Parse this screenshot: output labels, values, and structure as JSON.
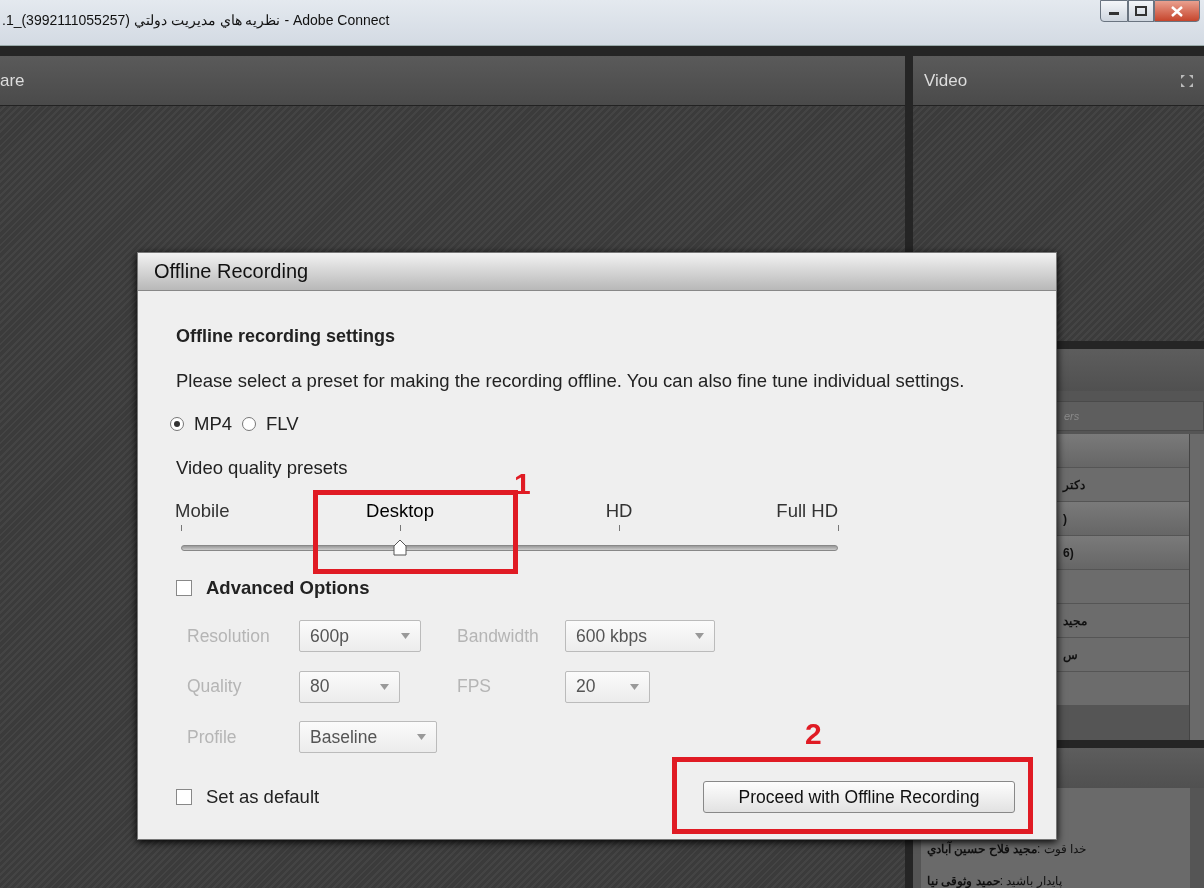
{
  "window": {
    "title": ".1_(3992111055257) نظريه هاي مديريت دولتي - Adobe Connect"
  },
  "share_pod": {
    "title": "are"
  },
  "video_pod": {
    "title": "Video"
  },
  "attendees_pod": {
    "search_placeholder": "ers",
    "rows": [
      {
        "kind": "group"
      },
      {
        "kind": "person",
        "text": "دکتر"
      },
      {
        "kind": "group",
        "text": ")"
      },
      {
        "kind": "group",
        "text": "6)"
      },
      {
        "kind": "person"
      },
      {
        "kind": "person",
        "text": "مجید"
      },
      {
        "kind": "person",
        "text": "س"
      },
      {
        "kind": "person"
      }
    ]
  },
  "chat_pod": {
    "messages": [
      {
        "text": "خدا قوت :**مجید فلاح حسین آبادي**"
      },
      {
        "text": "پایدار باشید :**حمید وثوقی نیا**"
      }
    ]
  },
  "dialog": {
    "title": "Offline Recording",
    "heading": "Offline recording settings",
    "description": "Please select a preset for making the recording offline. You can also fine tune individual settings.",
    "formats": [
      {
        "label": "MP4",
        "selected": true
      },
      {
        "label": "FLV",
        "selected": false
      }
    ],
    "presets_label": "Video quality presets",
    "presets": [
      {
        "label": "Mobile",
        "selected": false
      },
      {
        "label": "Desktop",
        "selected": true
      },
      {
        "label": "HD",
        "selected": false
      },
      {
        "label": "Full HD",
        "selected": false
      }
    ],
    "slider": {
      "level": 0.333
    },
    "advanced": {
      "label": "Advanced Options",
      "checked": false
    },
    "fields": [
      {
        "label": "Resolution",
        "value": "600p",
        "disabled": true
      },
      {
        "label": "Bandwidth",
        "value": "600 kbps",
        "disabled": true
      },
      {
        "label": "Quality",
        "value": "80",
        "disabled": true
      },
      {
        "label": "FPS",
        "value": "20",
        "disabled": true
      },
      {
        "label": "Profile",
        "value": "Baseline",
        "disabled": true
      }
    ],
    "set_default": {
      "label": "Set as default",
      "checked": false
    },
    "button": "Proceed with Offline Recording"
  },
  "annotations": [
    {
      "label": "1"
    },
    {
      "label": "2"
    }
  ]
}
